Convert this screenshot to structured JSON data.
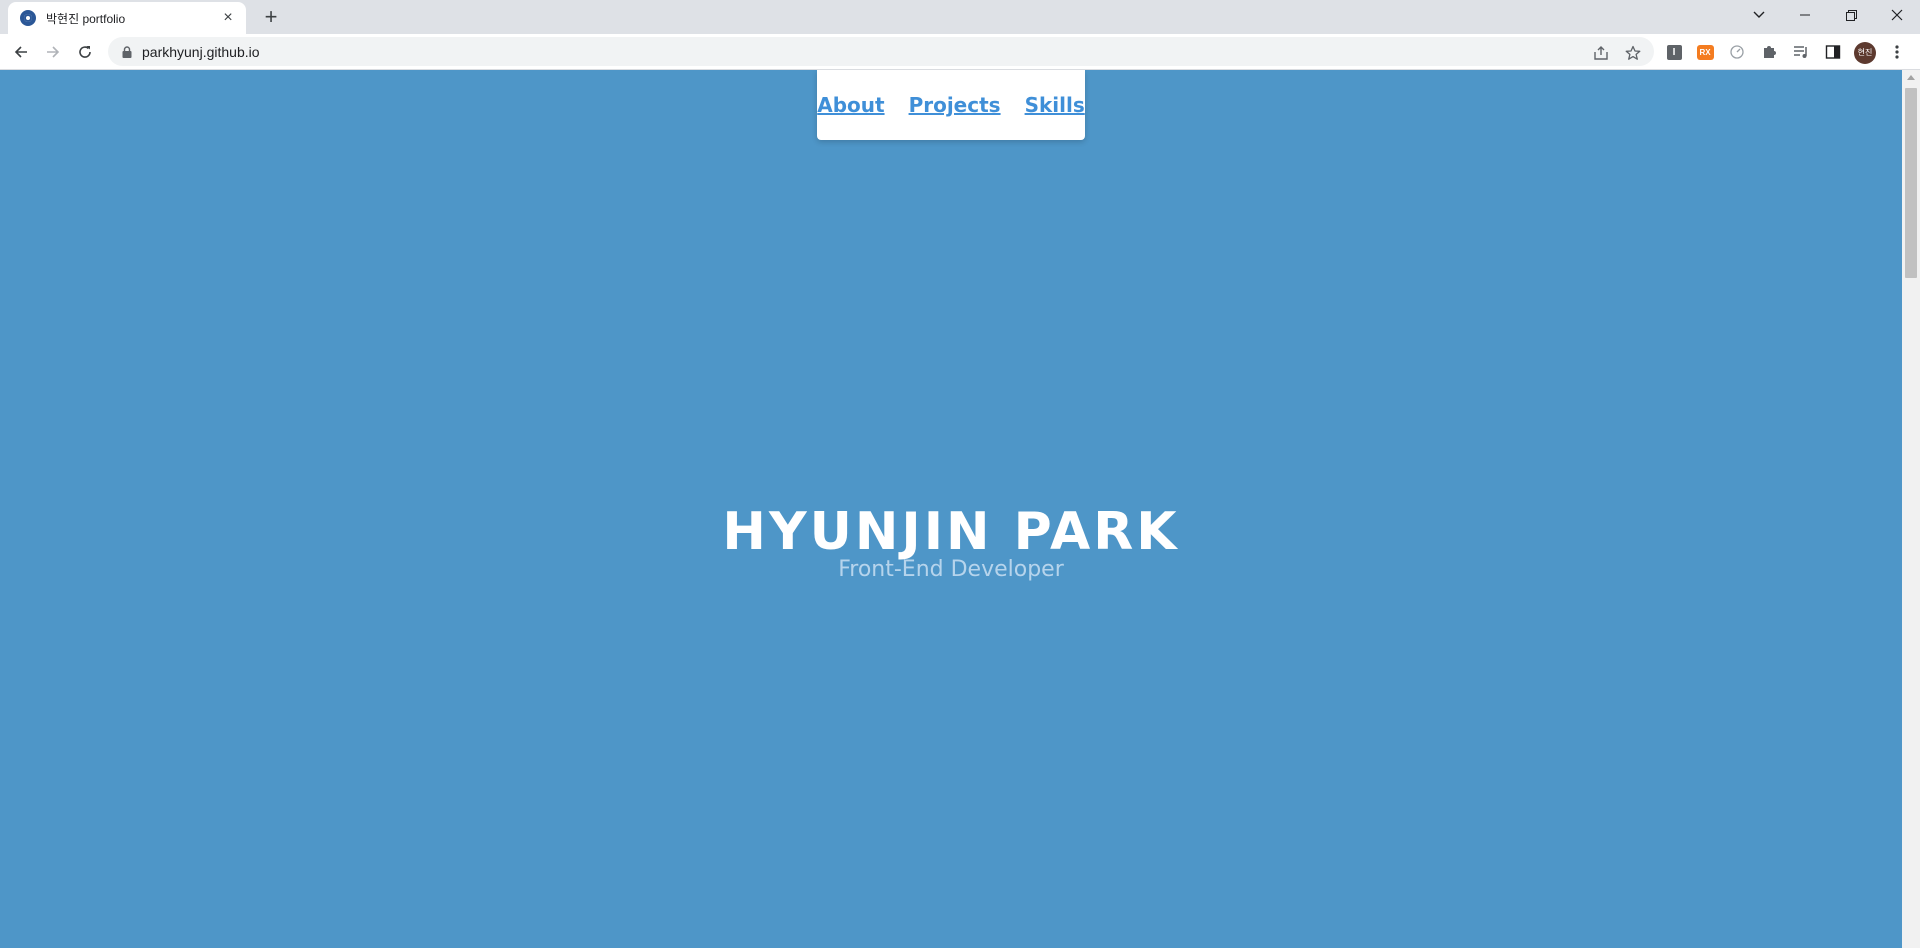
{
  "browser": {
    "tab": {
      "title": "박현진 portfolio",
      "close_glyph": "×"
    },
    "new_tab_glyph": "+",
    "address": "parkhyunj.github.io",
    "extensions": {
      "ext1_label": "I",
      "ext2_label": "RX"
    },
    "profile_initials": "현진"
  },
  "page": {
    "background_color": "#4e96c8",
    "nav": {
      "about": "About",
      "projects": "Projects",
      "skills": "Skills",
      "link_color": "#3f8fd8"
    },
    "hero": {
      "name": "HYUNJIN PARK",
      "role": "Front-End Developer"
    }
  }
}
